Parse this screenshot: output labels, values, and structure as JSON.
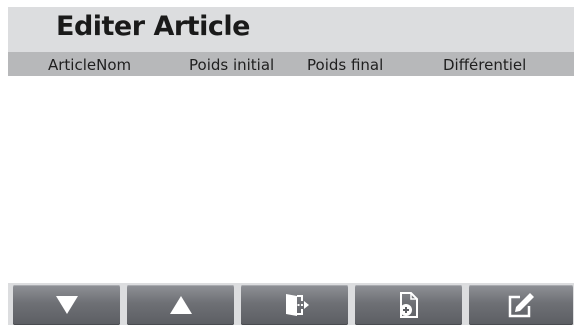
{
  "header": {
    "title": "Editer Article"
  },
  "table": {
    "columns": [
      "ArticleNom",
      "Poids initial",
      "Poids final",
      "Différentiel"
    ],
    "rows": []
  },
  "toolbar": {
    "buttons": [
      {
        "icon": "arrow-down-icon"
      },
      {
        "icon": "arrow-up-icon"
      },
      {
        "icon": "exit-icon"
      },
      {
        "icon": "add-file-icon"
      },
      {
        "icon": "edit-icon"
      }
    ]
  },
  "colors": {
    "title_bar": "#dcdddf",
    "header_row": "#b7b8ba",
    "button": "#6e7075",
    "icon": "#ffffff"
  }
}
